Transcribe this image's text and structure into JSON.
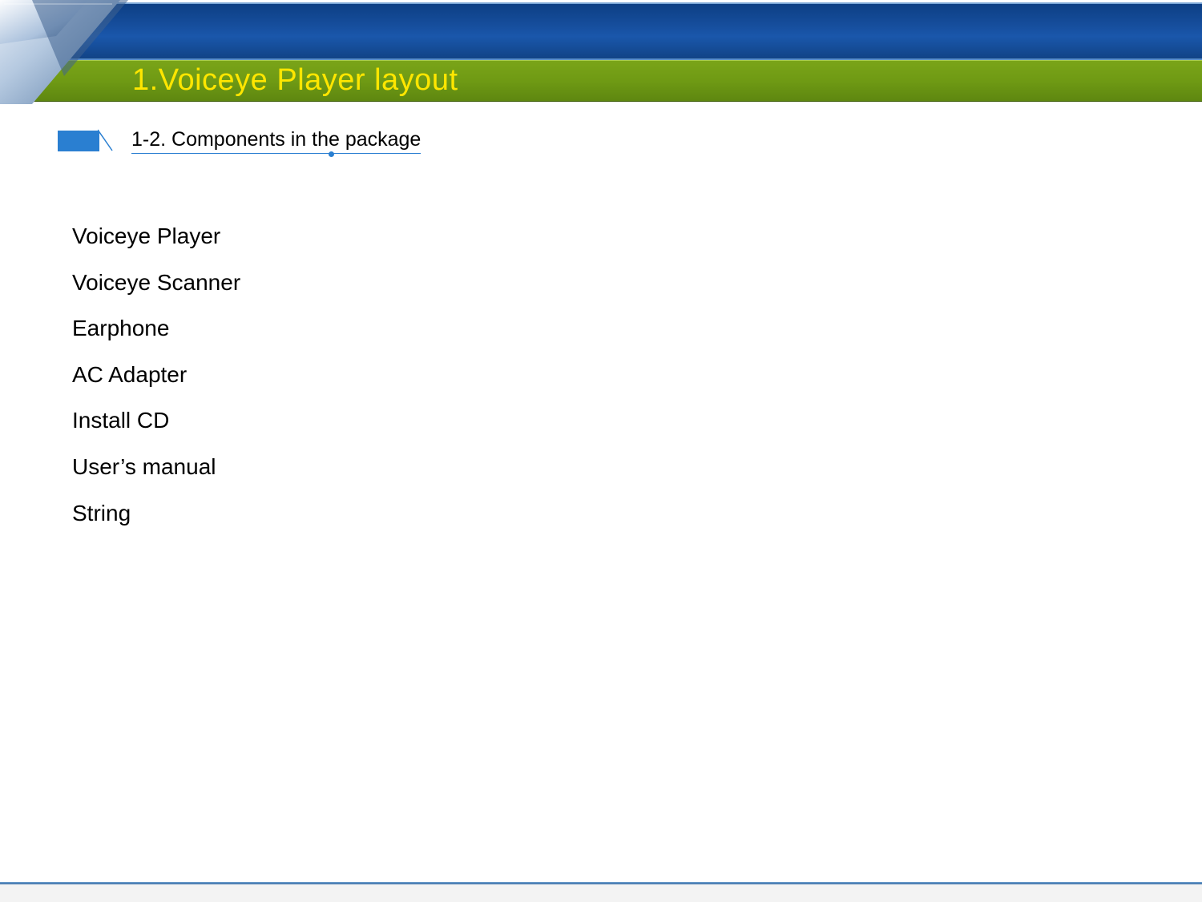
{
  "header": {
    "title": "1.Voiceye Player layout"
  },
  "subtitle": {
    "label": "1-2. Components in the package"
  },
  "components": [
    "Voiceye Player",
    "Voiceye Scanner",
    "Earphone",
    "AC Adapter",
    "Install CD",
    "User’s manual",
    "String"
  ]
}
